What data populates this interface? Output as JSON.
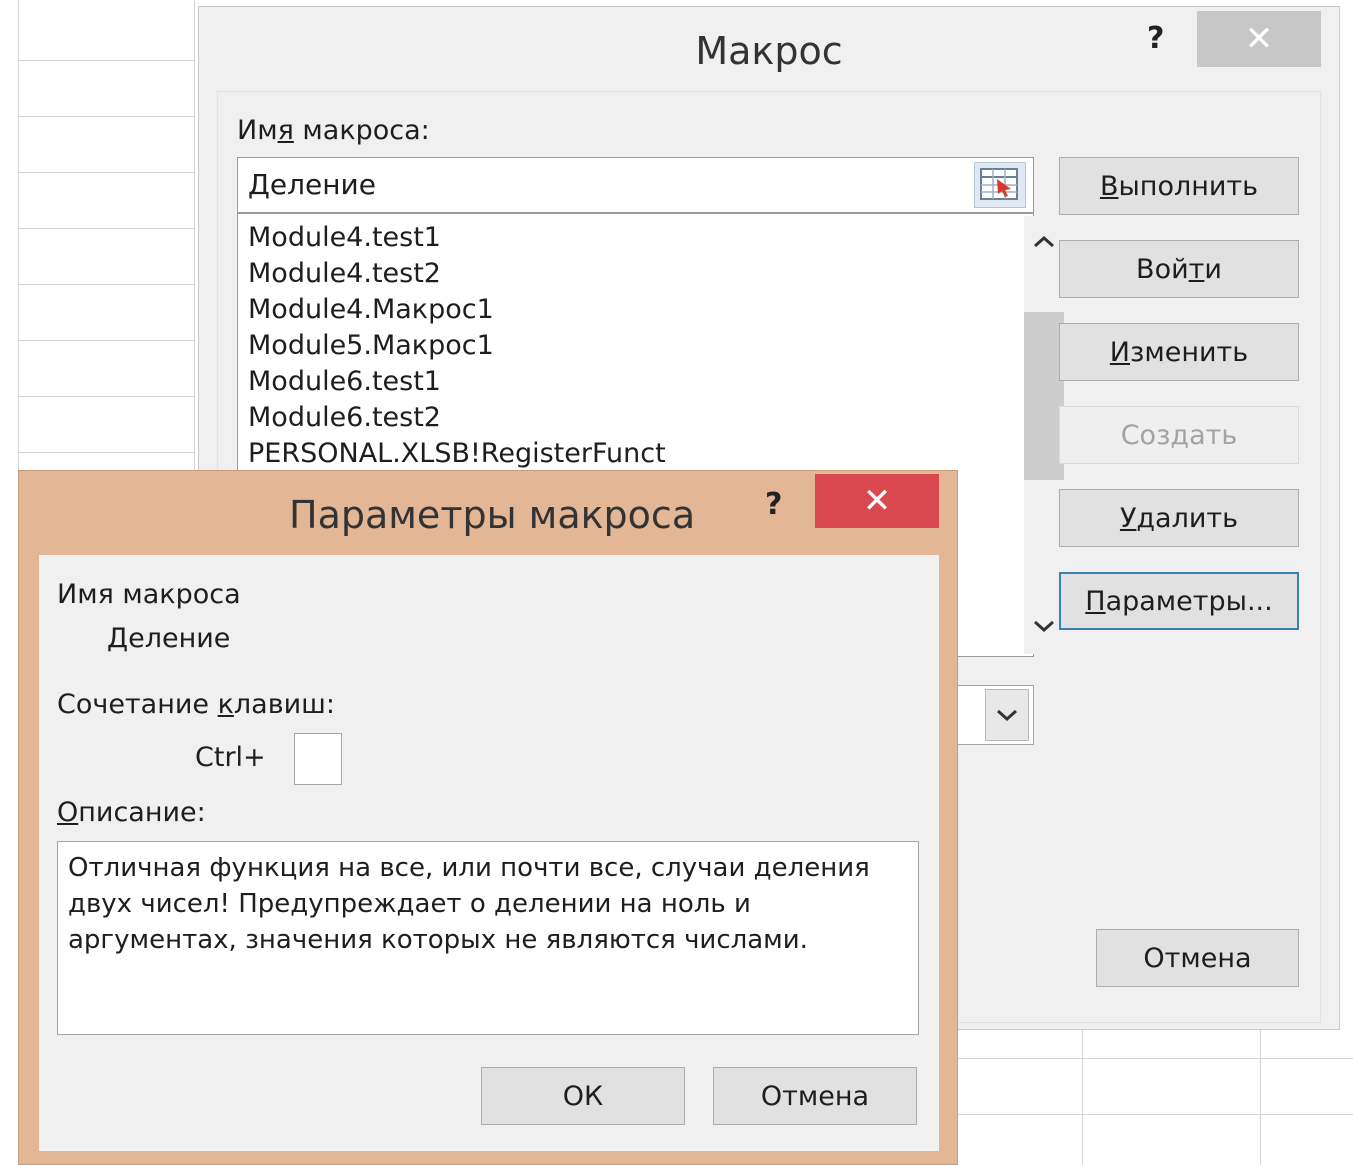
{
  "macro_dialog": {
    "title": "Макрос",
    "help": "?",
    "close": "✕",
    "name_label_pre": "Им",
    "name_label_ul": "я",
    "name_label_post": " макроса:",
    "name_value": "Деление",
    "list_items": [
      "Module4.test1",
      "Module4.test2",
      "Module4.Макрос1",
      "Module5.Макрос1",
      "Module6.test1",
      "Module6.test2",
      "PERSONAL.XLSB!RegisterFunct"
    ],
    "buttons": {
      "run": {
        "ul": "В",
        "rest": "ыполнить"
      },
      "step_pre": "Вой",
      "step_ul": "т",
      "step_post": "и",
      "edit": {
        "ul": "И",
        "rest": "зменить"
      },
      "create": "Создать",
      "delete": {
        "ul": "У",
        "rest": "далить"
      },
      "options": {
        "ul": "П",
        "rest": "араметры..."
      },
      "cancel": "Отмена"
    },
    "scroll_up": "^",
    "scroll_down": "v",
    "combo_arrow": "v"
  },
  "params_dialog": {
    "title": "Параметры макроса",
    "help": "?",
    "close": "✕",
    "name_label": "Имя макроса",
    "name_value": "Деление",
    "shortcut_label_pre": "Сочетание ",
    "shortcut_label_ul": "к",
    "shortcut_label_post": "лавиш:",
    "ctrl_prefix": "Ctrl+",
    "ctrl_value": "",
    "desc_label_ul": "О",
    "desc_label_rest": "писание:",
    "description": "Отличная функция на все, или почти все, случаи деления двух чисел! Предупреждает о делении на ноль и аргументах, значения которых не являются числами.",
    "ok": "ОК",
    "cancel": "Отмена"
  },
  "colors": {
    "params_frame": "#e3b795",
    "params_close": "#d9474f",
    "macro_close": "#c7c7c7",
    "focus_border": "#3c7fb1"
  }
}
